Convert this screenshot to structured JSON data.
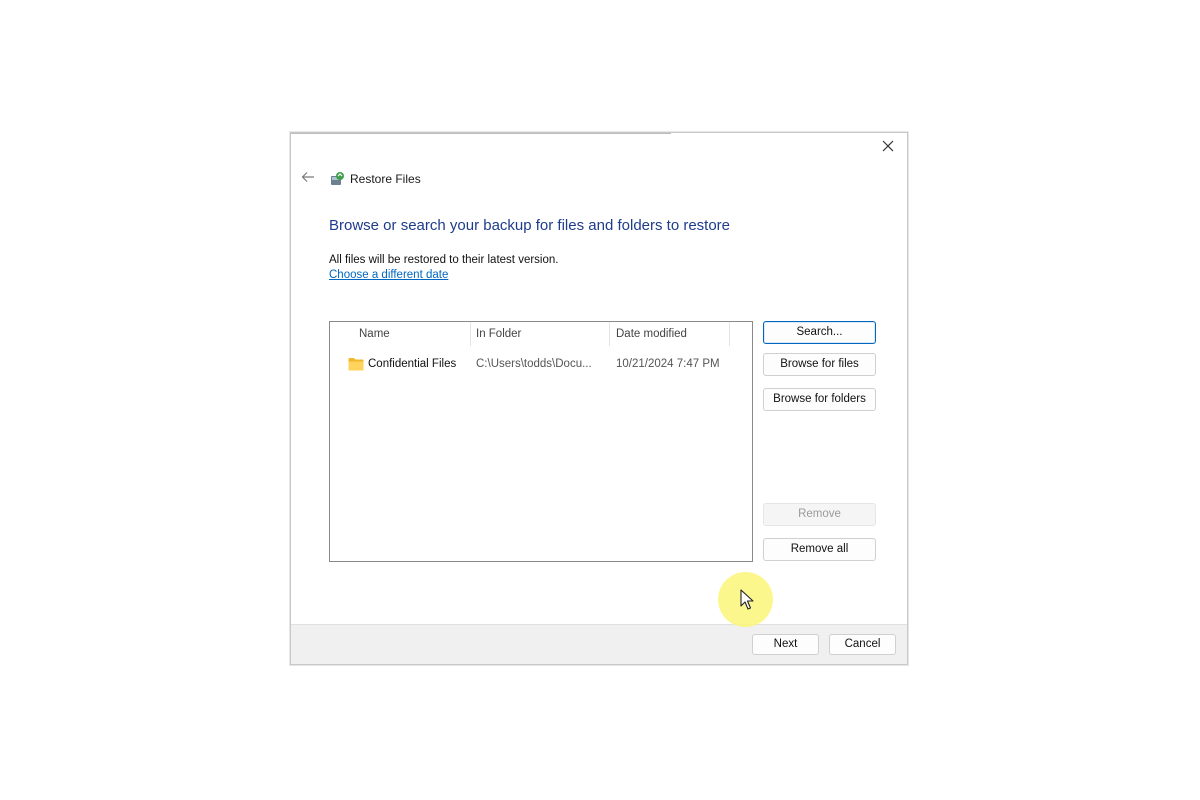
{
  "window": {
    "title": "Restore Files",
    "close_icon": "close-icon",
    "back_icon": "back-arrow-icon",
    "app_icon": "restore-files-icon"
  },
  "main": {
    "heading": "Browse or search your backup for files and folders to restore",
    "info_text": "All files will be restored to their latest version.",
    "date_link": "Choose a different date"
  },
  "file_list": {
    "columns": [
      "Name",
      "In Folder",
      "Date modified"
    ],
    "rows": [
      {
        "name": "Confidential Files",
        "folder": "C:\\Users\\todds\\Docu...",
        "date": "10/21/2024 7:47 PM",
        "icon": "folder-icon"
      }
    ]
  },
  "side_buttons": {
    "search": "Search...",
    "browse_files": "Browse for files",
    "browse_folders": "Browse for folders",
    "remove": "Remove",
    "remove_all": "Remove all"
  },
  "footer": {
    "next": "Next",
    "cancel": "Cancel"
  },
  "colors": {
    "heading": "#1e3c8c",
    "link": "#0067c0",
    "folder": "#f4c542",
    "cursor_highlight": "#fcf678"
  }
}
